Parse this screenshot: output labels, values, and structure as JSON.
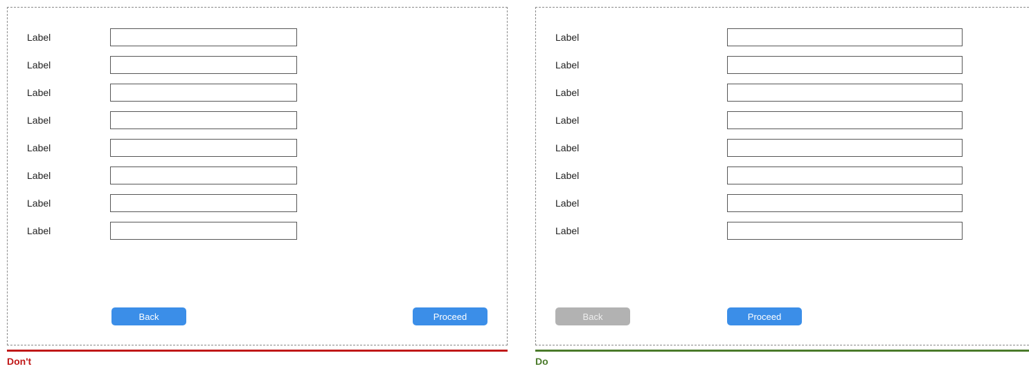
{
  "dont": {
    "rows": [
      {
        "label": "Label"
      },
      {
        "label": "Label"
      },
      {
        "label": "Label"
      },
      {
        "label": "Label"
      },
      {
        "label": "Label"
      },
      {
        "label": "Label"
      },
      {
        "label": "Label"
      },
      {
        "label": "Label"
      }
    ],
    "back_label": "Back",
    "proceed_label": "Proceed",
    "caption": "Don't"
  },
  "do": {
    "rows": [
      {
        "label": "Label"
      },
      {
        "label": "Label"
      },
      {
        "label": "Label"
      },
      {
        "label": "Label"
      },
      {
        "label": "Label"
      },
      {
        "label": "Label"
      },
      {
        "label": "Label"
      },
      {
        "label": "Label"
      }
    ],
    "back_label": "Back",
    "proceed_label": "Proceed",
    "caption": "Do"
  }
}
